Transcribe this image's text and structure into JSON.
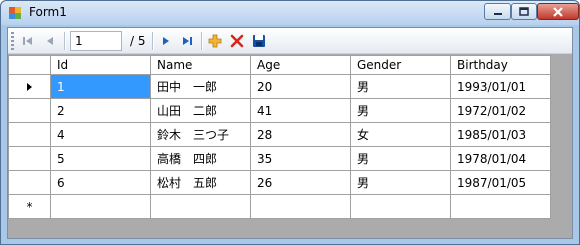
{
  "window": {
    "title": "Form1"
  },
  "toolbar": {
    "position_value": "1",
    "count_text": "/ 5",
    "icons": [
      "move-first-icon",
      "move-previous-icon",
      "move-next-icon",
      "move-last-icon",
      "add-icon",
      "delete-icon",
      "save-icon"
    ]
  },
  "grid": {
    "columns": [
      "Id",
      "Name",
      "Age",
      "Gender",
      "Birthday"
    ],
    "rows": [
      [
        "1",
        "田中　一郎",
        "20",
        "男",
        "1993/01/01"
      ],
      [
        "2",
        "山田　二郎",
        "41",
        "男",
        "1972/01/02"
      ],
      [
        "4",
        "鈴木　三つ子",
        "28",
        "女",
        "1985/01/03"
      ],
      [
        "5",
        "高橋　四郎",
        "35",
        "男",
        "1978/01/04"
      ],
      [
        "6",
        "松村　五郎",
        "26",
        "男",
        "1987/01/05"
      ]
    ],
    "new_row_marker": "*",
    "selected_row": 0,
    "selected_cell": "Id"
  },
  "colors": {
    "selection": "#3399ff",
    "add_icon": "#e8a317",
    "delete_icon": "#d9261c",
    "save_icon": "#1a4fa0"
  }
}
